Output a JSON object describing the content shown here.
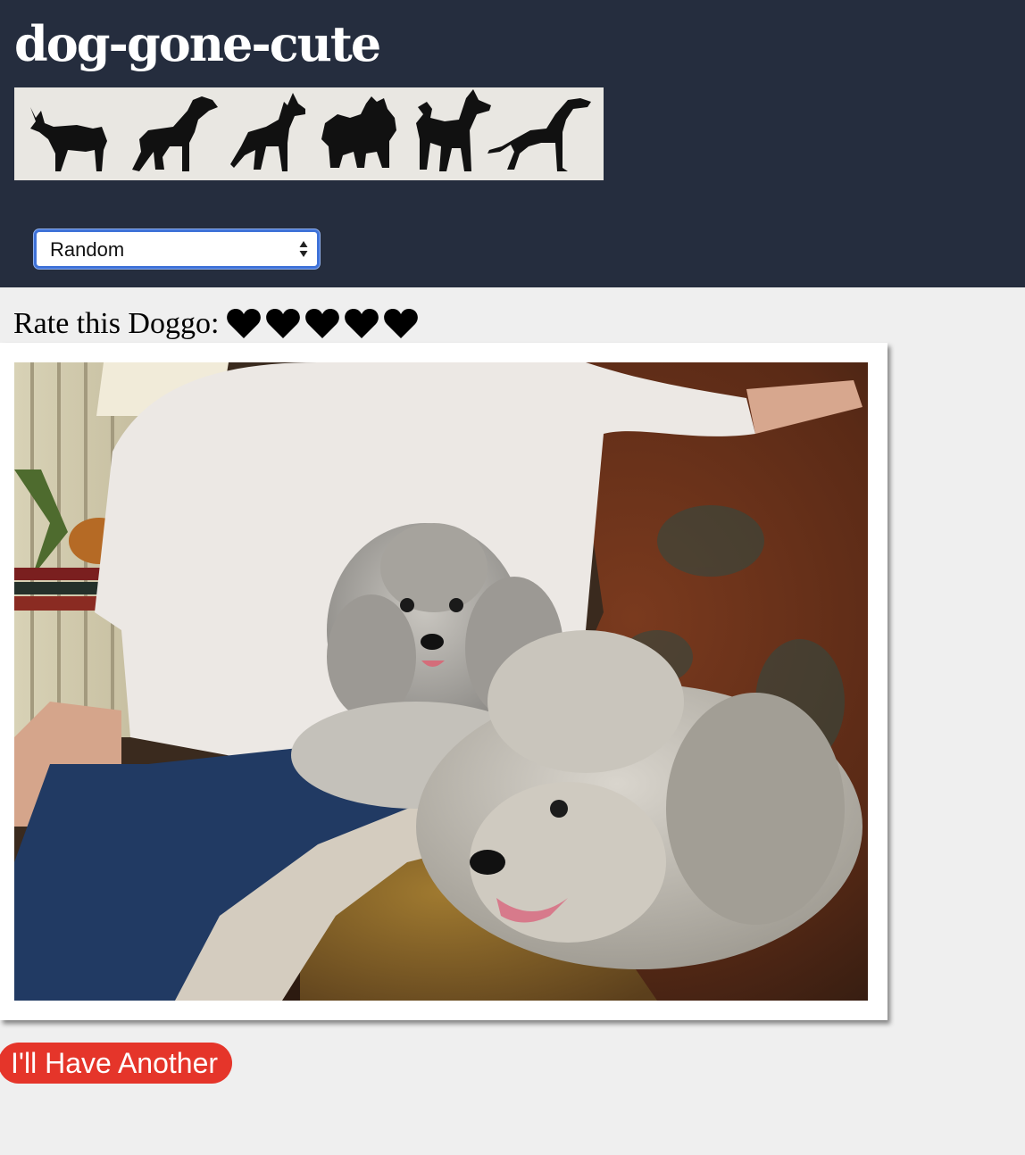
{
  "site": {
    "title": "dog-gone-cute"
  },
  "banner": {
    "icon": "dog-silhouettes-banner"
  },
  "breed_select": {
    "selected": "Random",
    "icon": "select-arrows-icon"
  },
  "rating": {
    "label": "Rate this Doggo:",
    "max": 5,
    "icon": "heart-icon",
    "color": "#000000"
  },
  "photo": {
    "subject": "dog-photo"
  },
  "actions": {
    "another_label": "I'll Have Another",
    "another_color": "#e5352a"
  },
  "colors": {
    "header_bg": "#252d3e",
    "page_bg": "#efefef"
  }
}
